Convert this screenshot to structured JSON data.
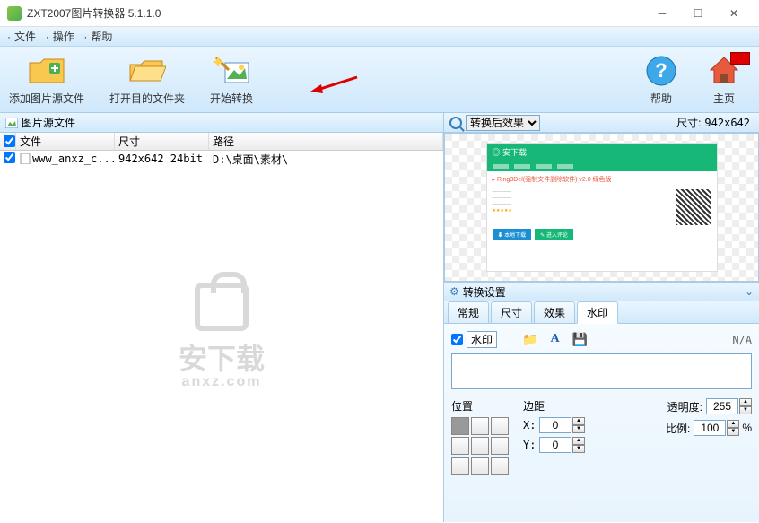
{
  "title": "ZXT2007图片转换器 5.1.1.0",
  "menu": {
    "file": "文件",
    "operate": "操作",
    "help": "帮助",
    "dot": "·"
  },
  "toolbar": {
    "add": "添加图片源文件",
    "open": "打开目的文件夹",
    "start": "开始转换",
    "help": "帮助",
    "home": "主页"
  },
  "source_panel": {
    "title": "图片源文件",
    "columns": {
      "file": "文件",
      "size": "尺寸",
      "path": "路径"
    },
    "rows": [
      {
        "file": "www_anxz_c...",
        "size": "942x642  24bit",
        "path": "D:\\桌面\\素材\\"
      }
    ]
  },
  "watermark_brand": {
    "name": "安下载",
    "domain": "anxz.com"
  },
  "preview": {
    "dropdown": "转换后效果",
    "size_label": "尺寸:",
    "size_value": "942x642"
  },
  "settings": {
    "title": "转换设置",
    "tabs": {
      "general": "常规",
      "size": "尺寸",
      "effect": "效果",
      "watermark": "水印"
    },
    "watermark": {
      "checkbox": "水印",
      "na": "N/A",
      "position_label": "位置",
      "margin_label": "边距",
      "x_label": "X:",
      "y_label": "Y:",
      "x_value": "0",
      "y_value": "0",
      "opacity_label": "透明度:",
      "opacity_value": "255",
      "scale_label": "比例:",
      "scale_value": "100",
      "percent": "%"
    }
  }
}
